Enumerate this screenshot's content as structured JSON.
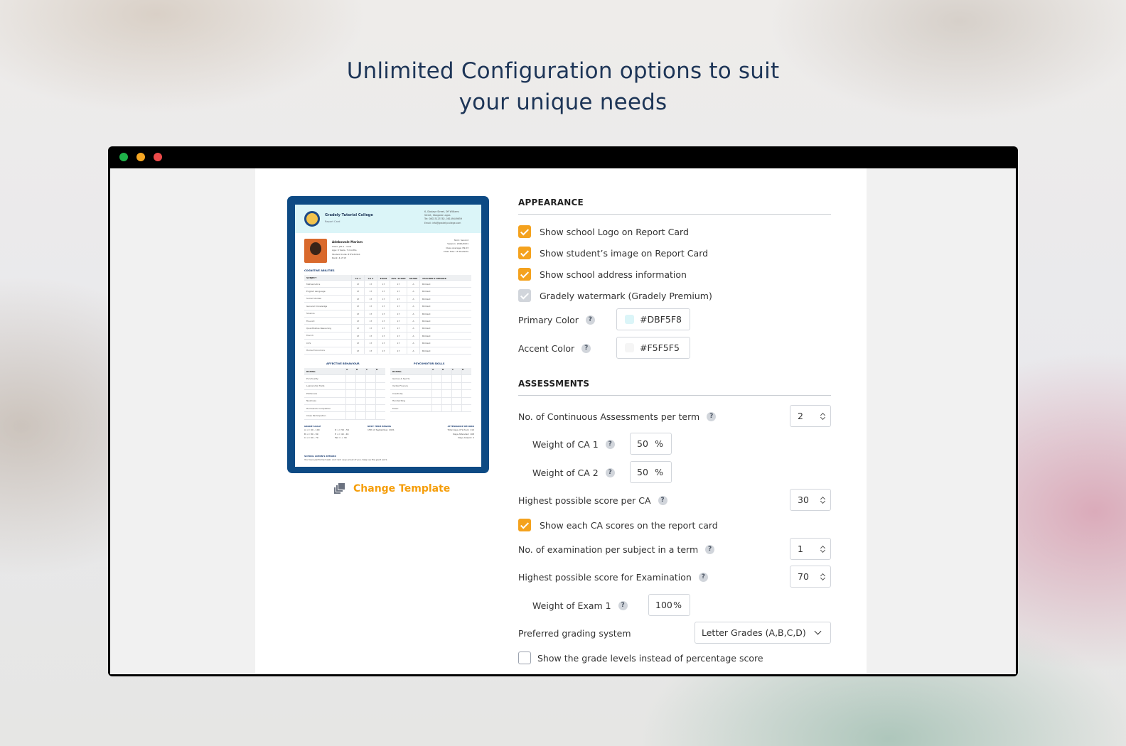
{
  "headline": {
    "line1": "Unlimited Configuration options to suit",
    "line2": "your unique needs"
  },
  "window": {
    "controls": [
      "close-green",
      "minimize-yellow",
      "maximize-red"
    ]
  },
  "report_card": {
    "school_name": "Gradely Tutorial College",
    "subtitle": "Report Card",
    "address_lines": [
      "6, Gbolaye Street, Off Williams",
      "Street, Gbagada Lagos",
      "Tel: 08023123782, 08149449659",
      "Email: info@gradelycollege.com"
    ],
    "student_name": "Adebowale Mariam",
    "student_meta": [
      "Class: JSS 1 - Gold",
      "Age: 9 Years, 7 months",
      "Student Code: 87FG31911",
      "Rank: 4 of 15"
    ],
    "term_meta": [
      "Term: Second",
      "Session: 2020/2021",
      "Class Average: 89.03",
      "Class Size: 15 Students"
    ],
    "section_cognitive": "COGNITIVE ABILITIES",
    "table_headers": [
      "SUBJECT",
      "CA 1",
      "CA 2",
      "EXAM",
      "AVG. SCORE",
      "GRADE",
      "TEACHER'S REMARK"
    ],
    "subjects": [
      "Mathematics",
      "English Language",
      "Social Studies",
      "General Knowledge",
      "Science",
      "Fine Art",
      "Quantitative Reasoning",
      "French",
      "CCS",
      "Home Economics"
    ],
    "cell_score": "17",
    "cell_grade": "A",
    "cell_remark": "Brilliant",
    "section_affective": "AFFECTIVE BEHAVIOUR",
    "section_psychomotor": "PSYCOMOTOR SKILLS",
    "mini_headers": [
      "RATING",
      "A",
      "B",
      "C",
      "D"
    ],
    "affective_items": [
      "Punctuality",
      "Leadership Traits",
      "Politeness",
      "Neatness",
      "Homework Completion",
      "Class Participation"
    ],
    "psychomotor_items": [
      "Games & Sports",
      "Verbal Fluency",
      "Creativity",
      "Handwriting",
      "Music"
    ],
    "grade_scale_title": "GRADE SCALE",
    "grade_scale": [
      "A >= 90 - 100",
      "B >= 80 - 89",
      "C >= 60 - 79",
      "D >= 50 - 59",
      "E >= 40 - 49",
      "Fail = < 39"
    ],
    "next_term_title": "NEXT TERM BEGINS",
    "next_term_date": "15th of September, 2021",
    "attendance_title": "ATTENDANCE RECORD",
    "attendance": [
      "Total days of School: 110",
      "Days Attended: 108",
      "Days Absent: 2"
    ],
    "remarks_title": "SCHOOL ADMIN'S REMARK",
    "remarks_text": "You have performed well, and I am very proud of you. Keep up the good work."
  },
  "change_template": {
    "label": "Change Template",
    "icon": "template-stack-icon"
  },
  "appearance": {
    "title": "APPEARANCE",
    "show_logo": {
      "label": "Show school Logo on Report Card",
      "checked": true
    },
    "show_image": {
      "label": "Show student’s image on Report Card",
      "checked": true
    },
    "show_address": {
      "label": "Show school address information",
      "checked": true
    },
    "watermark": {
      "label": "Gradely watermark (Gradely Premium)",
      "checked": true,
      "disabled": true
    },
    "primary_color": {
      "label": "Primary Color",
      "value": "#DBF5F8",
      "swatch": "#dbf5f8"
    },
    "accent_color": {
      "label": "Accent Color",
      "value": "#F5F5F5",
      "swatch": "#f5f5f5"
    }
  },
  "assessments": {
    "title": "ASSESSMENTS",
    "num_ca": {
      "label": "No. of Continuous Assessments per term",
      "value": "2"
    },
    "weight_ca1": {
      "label": "Weight of CA 1",
      "value": "50",
      "unit": "%"
    },
    "weight_ca2": {
      "label": "Weight of CA 2",
      "value": "50",
      "unit": "%"
    },
    "highest_ca": {
      "label": "Highest possible score per CA",
      "value": "30"
    },
    "show_ca_scores": {
      "label": "Show each CA scores on the report card",
      "checked": true
    },
    "num_exam": {
      "label": "No. of examination per subject in a term",
      "value": "1"
    },
    "highest_exam": {
      "label": "Highest possible score for Examination",
      "value": "70"
    },
    "weight_exam1": {
      "label": "Weight of Exam 1",
      "value": "100",
      "unit": "%"
    },
    "grading": {
      "label": "Preferred grading system",
      "value": "Letter Grades (A,B,C,D)"
    },
    "show_grade_levels": {
      "label": "Show the grade levels instead of percentage score",
      "checked": false
    }
  },
  "help_glyph": "?",
  "colors": {
    "accent_orange": "#f4a21e",
    "headline": "#1d3557",
    "card_frame": "#0d4a84"
  }
}
